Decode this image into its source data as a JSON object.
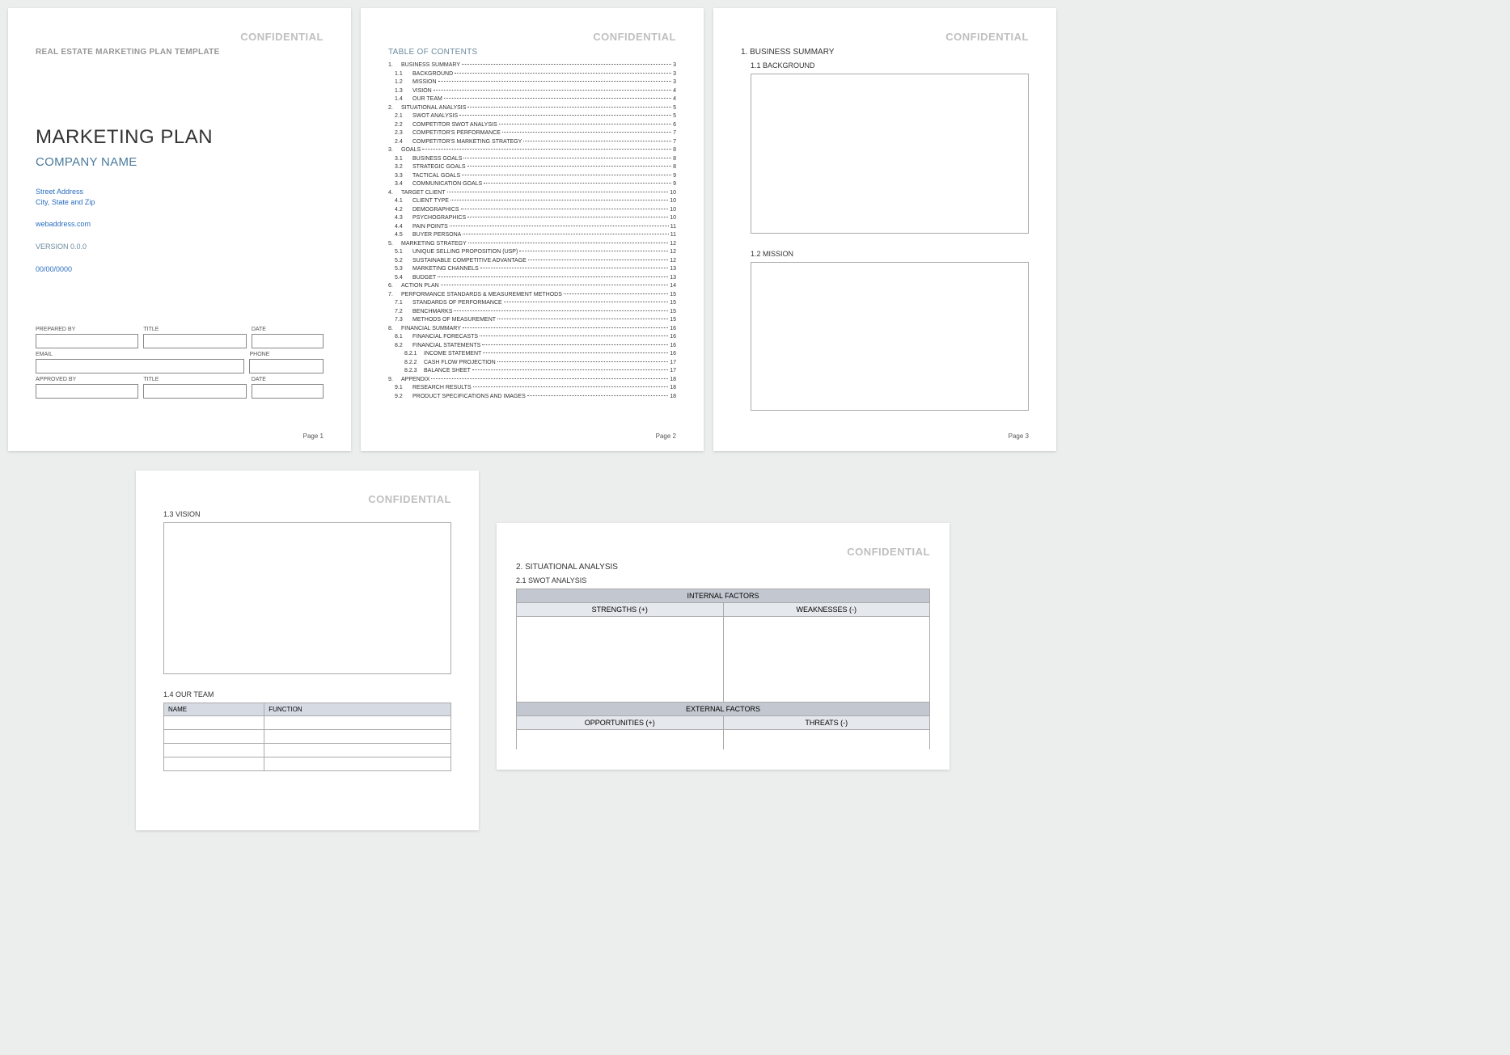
{
  "confidential": "CONFIDENTIAL",
  "page1": {
    "template_label": "REAL ESTATE MARKETING PLAN TEMPLATE",
    "title": "MARKETING PLAN",
    "company": "COMPANY NAME",
    "street": "Street Address",
    "city": "City, State and Zip",
    "web": "webaddress.com",
    "version": "VERSION 0.0.0",
    "date": "00/00/0000",
    "form": {
      "prepared_by": "PREPARED BY",
      "title": "TITLE",
      "date_lbl": "DATE",
      "email": "EMAIL",
      "phone": "PHONE",
      "approved_by": "APPROVED BY"
    },
    "pagenum": "Page 1"
  },
  "page2": {
    "toc_title": "TABLE OF CONTENTS",
    "entries": [
      {
        "lvl": 1,
        "num": "1.",
        "text": "BUSINESS SUMMARY",
        "pg": "3"
      },
      {
        "lvl": 2,
        "num": "1.1",
        "text": "BACKGROUND",
        "pg": "3"
      },
      {
        "lvl": 2,
        "num": "1.2",
        "text": "MISSION",
        "pg": "3"
      },
      {
        "lvl": 2,
        "num": "1.3",
        "text": "VISION",
        "pg": "4"
      },
      {
        "lvl": 2,
        "num": "1.4",
        "text": "OUR TEAM",
        "pg": "4"
      },
      {
        "lvl": 1,
        "num": "2.",
        "text": "SITUATIONAL ANALYSIS",
        "pg": "5"
      },
      {
        "lvl": 2,
        "num": "2.1",
        "text": "SWOT ANALYSIS",
        "pg": "5"
      },
      {
        "lvl": 2,
        "num": "2.2",
        "text": "COMPETITOR SWOT ANALYSIS",
        "pg": "6"
      },
      {
        "lvl": 2,
        "num": "2.3",
        "text": "COMPETITOR'S PERFORMANCE",
        "pg": "7"
      },
      {
        "lvl": 2,
        "num": "2.4",
        "text": "COMPETITOR'S MARKETING STRATEGY",
        "pg": "7"
      },
      {
        "lvl": 1,
        "num": "3.",
        "text": "GOALS",
        "pg": "8"
      },
      {
        "lvl": 2,
        "num": "3.1",
        "text": "BUSINESS GOALS",
        "pg": "8"
      },
      {
        "lvl": 2,
        "num": "3.2",
        "text": "STRATEGIC GOALS",
        "pg": "8"
      },
      {
        "lvl": 2,
        "num": "3.3",
        "text": "TACTICAL GOALS",
        "pg": "9"
      },
      {
        "lvl": 2,
        "num": "3.4",
        "text": "COMMUNICATION GOALS",
        "pg": "9"
      },
      {
        "lvl": 1,
        "num": "4.",
        "text": "TARGET CLIENT",
        "pg": "10"
      },
      {
        "lvl": 2,
        "num": "4.1",
        "text": "CLIENT TYPE",
        "pg": "10"
      },
      {
        "lvl": 2,
        "num": "4.2",
        "text": "DEMOGRAPHICS",
        "pg": "10"
      },
      {
        "lvl": 2,
        "num": "4.3",
        "text": "PSYCHOGRAPHICS",
        "pg": "10"
      },
      {
        "lvl": 2,
        "num": "4.4",
        "text": "PAIN POINTS",
        "pg": "11"
      },
      {
        "lvl": 2,
        "num": "4.5",
        "text": "BUYER PERSONA",
        "pg": "11"
      },
      {
        "lvl": 1,
        "num": "5.",
        "text": "MARKETING STRATEGY",
        "pg": "12"
      },
      {
        "lvl": 2,
        "num": "5.1",
        "text": "UNIQUE SELLING PROPOSITION (USP)",
        "pg": "12"
      },
      {
        "lvl": 2,
        "num": "5.2",
        "text": "SUSTAINABLE COMPETITIVE ADVANTAGE",
        "pg": "12"
      },
      {
        "lvl": 2,
        "num": "5.3",
        "text": "MARKETING CHANNELS",
        "pg": "13"
      },
      {
        "lvl": 2,
        "num": "5.4",
        "text": "BUDGET",
        "pg": "13"
      },
      {
        "lvl": 1,
        "num": "6.",
        "text": "ACTION PLAN",
        "pg": "14"
      },
      {
        "lvl": 1,
        "num": "7.",
        "text": "PERFORMANCE STANDARDS & MEASUREMENT METHODS",
        "pg": "15"
      },
      {
        "lvl": 2,
        "num": "7.1",
        "text": "STANDARDS OF PERFORMANCE",
        "pg": "15"
      },
      {
        "lvl": 2,
        "num": "7.2",
        "text": "BENCHMARKS",
        "pg": "15"
      },
      {
        "lvl": 2,
        "num": "7.3",
        "text": "METHODS OF MEASUREMENT",
        "pg": "15"
      },
      {
        "lvl": 1,
        "num": "8.",
        "text": "FINANCIAL SUMMARY",
        "pg": "16"
      },
      {
        "lvl": 2,
        "num": "8.1",
        "text": "FINANCIAL FORECASTS",
        "pg": "16"
      },
      {
        "lvl": 2,
        "num": "8.2",
        "text": "FINANCIAL STATEMENTS",
        "pg": "16"
      },
      {
        "lvl": 3,
        "num": "8.2.1",
        "text": "INCOME STATEMENT",
        "pg": "16"
      },
      {
        "lvl": 3,
        "num": "8.2.2",
        "text": "CASH FLOW PROJECTION",
        "pg": "17"
      },
      {
        "lvl": 3,
        "num": "8.2.3",
        "text": "BALANCE SHEET",
        "pg": "17"
      },
      {
        "lvl": 1,
        "num": "9.",
        "text": "APPENDIX",
        "pg": "18"
      },
      {
        "lvl": 2,
        "num": "9.1",
        "text": "RESEARCH RESULTS",
        "pg": "18"
      },
      {
        "lvl": 2,
        "num": "9.2",
        "text": "PRODUCT SPECIFICATIONS AND IMAGES",
        "pg": "18"
      }
    ],
    "pagenum": "Page 2"
  },
  "page3": {
    "h1": "1.  BUSINESS SUMMARY",
    "h2_1": "1.1  BACKGROUND",
    "h2_2": "1.2  MISSION",
    "pagenum": "Page 3"
  },
  "page4": {
    "h2_1": "1.3  VISION",
    "h2_2": "1.4  OUR TEAM",
    "team_headers": {
      "name": "NAME",
      "function": "FUNCTION"
    }
  },
  "page5": {
    "h1": "2.  SITUATIONAL ANALYSIS",
    "h2_1": "2.1  SWOT ANALYSIS",
    "swot": {
      "internal": "INTERNAL FACTORS",
      "external": "EXTERNAL FACTORS",
      "strengths": "STRENGTHS (+)",
      "weaknesses": "WEAKNESSES (-)",
      "opportunities": "OPPORTUNITIES (+)",
      "threats": "THREATS (-)"
    }
  }
}
